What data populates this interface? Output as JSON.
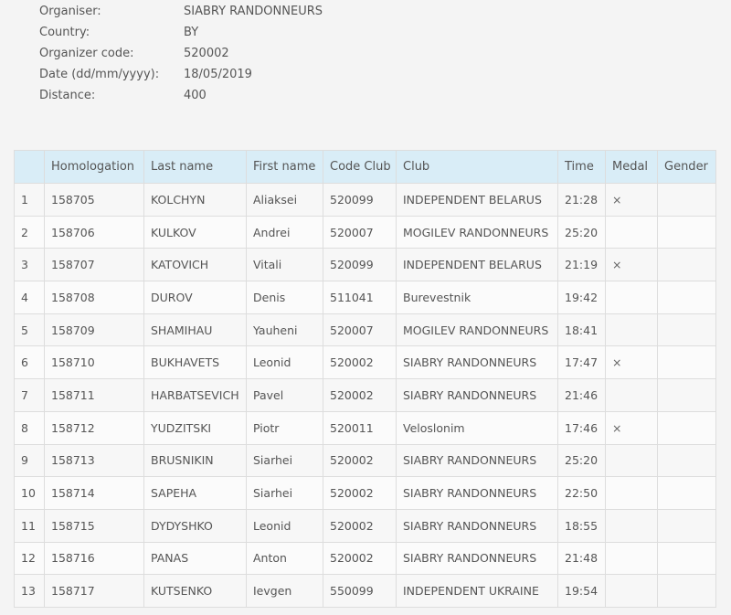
{
  "info": {
    "rows": [
      {
        "label": "Organiser:",
        "value": "SIABRY RANDONNEURS"
      },
      {
        "label": "Country:",
        "value": "BY"
      },
      {
        "label": "Organizer code:",
        "value": "520002"
      },
      {
        "label": "Date (dd/mm/yyyy):",
        "value": "18/05/2019"
      },
      {
        "label": "Distance:",
        "value": "400"
      }
    ]
  },
  "table": {
    "headers": [
      "",
      "Homologation",
      "Last name",
      "First name",
      "Code Club",
      "Club",
      "Time",
      "Medal",
      "Gender"
    ],
    "rows": [
      [
        "1",
        "158705",
        "KOLCHYN",
        "Aliaksei",
        "520099",
        "INDEPENDENT BELARUS",
        "21:28",
        "×",
        ""
      ],
      [
        "2",
        "158706",
        "KULKOV",
        "Andrei",
        "520007",
        "MOGILEV RANDONNEURS",
        "25:20",
        "",
        ""
      ],
      [
        "3",
        "158707",
        "KATOVICH",
        "Vitali",
        "520099",
        "INDEPENDENT BELARUS",
        "21:19",
        "×",
        ""
      ],
      [
        "4",
        "158708",
        "DUROV",
        "Denis",
        "511041",
        "Burevestnik",
        "19:42",
        "",
        ""
      ],
      [
        "5",
        "158709",
        "SHAMIHAU",
        "Yauheni",
        "520007",
        "MOGILEV RANDONNEURS",
        "18:41",
        "",
        ""
      ],
      [
        "6",
        "158710",
        "BUKHAVETS",
        "Leonid",
        "520002",
        "SIABRY RANDONNEURS",
        "17:47",
        "×",
        ""
      ],
      [
        "7",
        "158711",
        "HARBATSEVICH",
        "Pavel",
        "520002",
        "SIABRY RANDONNEURS",
        "21:46",
        "",
        ""
      ],
      [
        "8",
        "158712",
        "YUDZITSKI",
        "Piotr",
        "520011",
        "Veloslonim",
        "17:46",
        "×",
        ""
      ],
      [
        "9",
        "158713",
        "BRUSNIKIN",
        "Siarhei",
        "520002",
        "SIABRY RANDONNEURS",
        "25:20",
        "",
        ""
      ],
      [
        "10",
        "158714",
        "SAPEHA",
        "Siarhei",
        "520002",
        "SIABRY RANDONNEURS",
        "22:50",
        "",
        ""
      ],
      [
        "11",
        "158715",
        "DYDYSHKO",
        "Leonid",
        "520002",
        "SIABRY RANDONNEURS",
        "18:55",
        "",
        ""
      ],
      [
        "12",
        "158716",
        "PANAS",
        "Anton",
        "520002",
        "SIABRY RANDONNEURS",
        "21:48",
        "",
        ""
      ],
      [
        "13",
        "158717",
        "KUTSENKO",
        "Ievgen",
        "550099",
        "INDEPENDENT UKRAINE",
        "19:54",
        "",
        ""
      ]
    ]
  }
}
